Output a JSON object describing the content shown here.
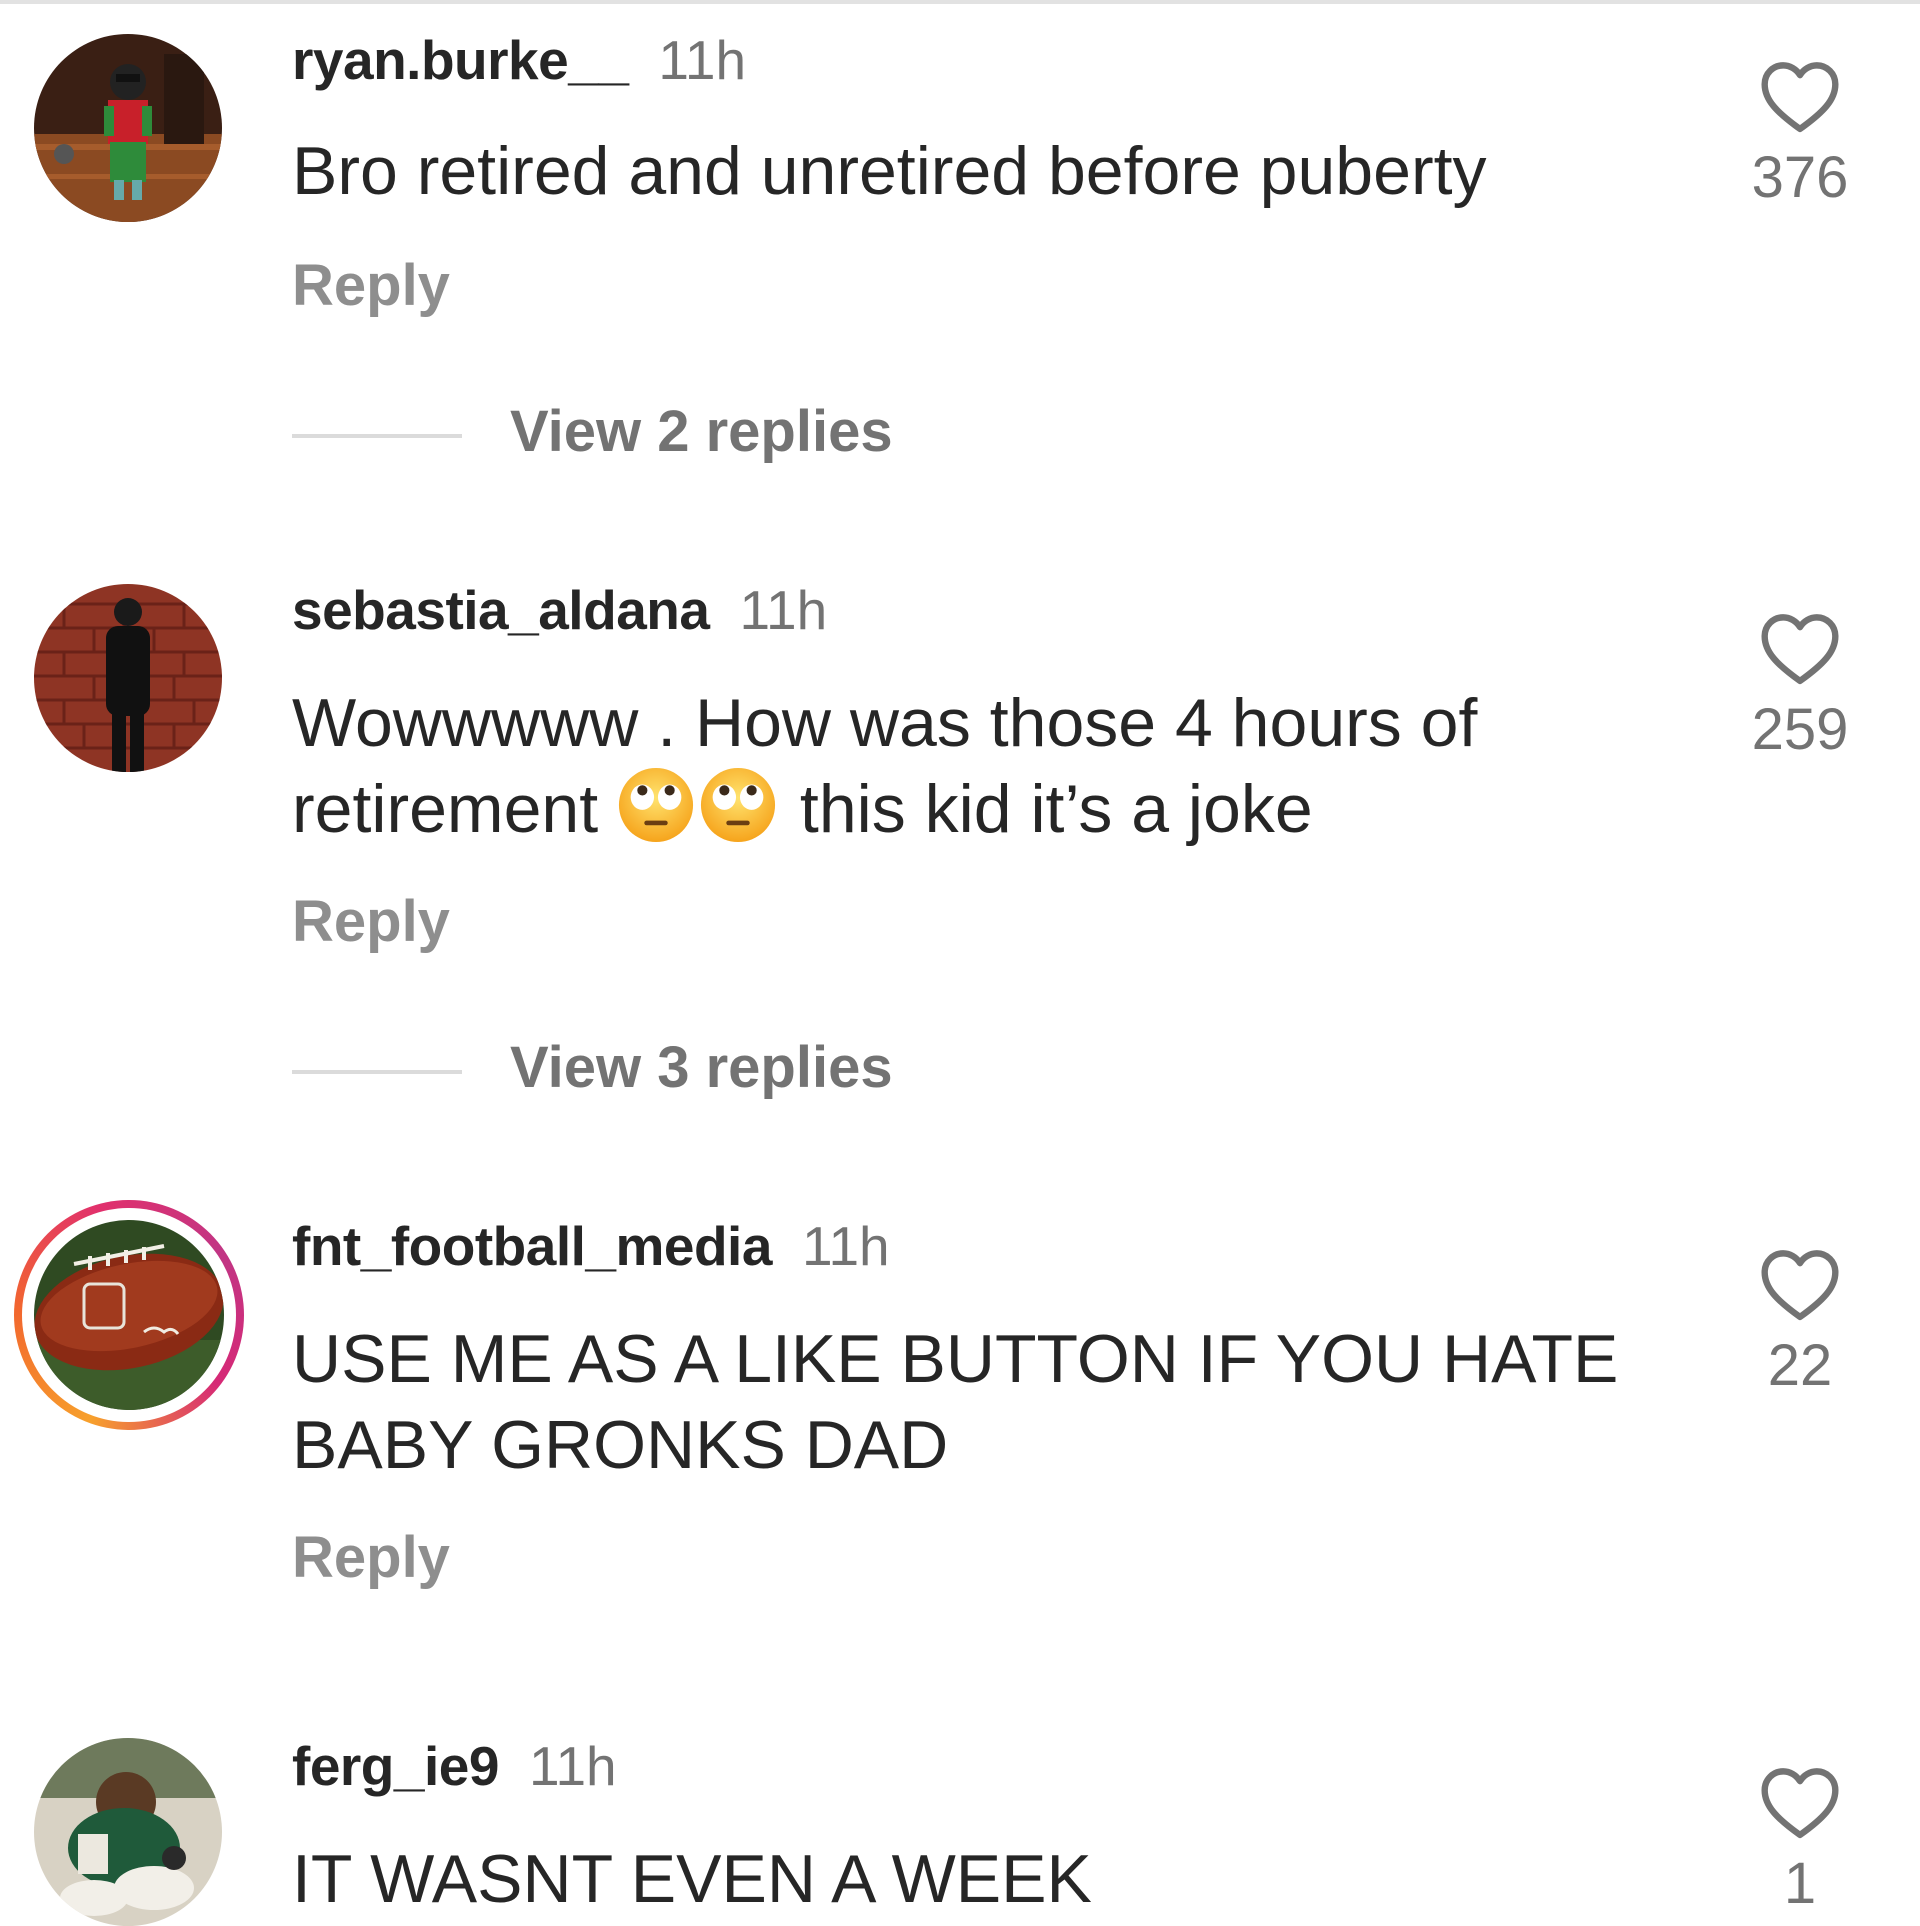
{
  "comments": [
    {
      "username": "ryan.burke__",
      "time": "11h",
      "text": "Bro retired and unretired before puberty",
      "reply_label": "Reply",
      "likes": "376",
      "view_replies": "View 2 replies"
    },
    {
      "username": "sebastia_aldana",
      "time": "11h",
      "text_line1": "Wowwwww . How was those 4 hours of",
      "text_line2a": "retirement",
      "text_line2b": "this kid it’s a joke",
      "emoji_name": "face-with-rolling-eyes-emoji",
      "reply_label": "Reply",
      "likes": "259",
      "view_replies": "View 3 replies"
    },
    {
      "username": "fnt_football_media",
      "time": "11h",
      "text_line1": "USE ME AS A LIKE BUTTON IF YOU HATE",
      "text_line2": "BABY GRONKS DAD",
      "reply_label": "Reply",
      "likes": "22"
    },
    {
      "username": "ferg_ie9",
      "time": "11h",
      "text": "IT WASNT EVEN A WEEK",
      "likes": "1"
    }
  ],
  "icons": {
    "like": "heart-outline-icon"
  },
  "colors": {
    "text": "#262626",
    "secondary": "#737373",
    "story_ring_start": "#f7a02c",
    "story_ring_end": "#c13584"
  }
}
